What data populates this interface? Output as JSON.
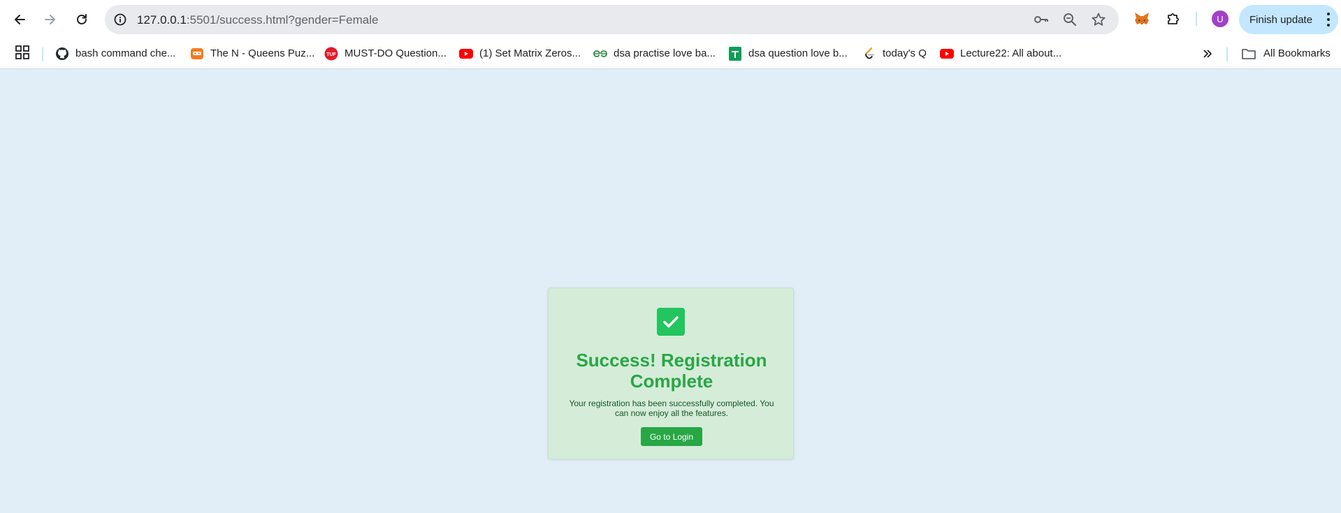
{
  "browser": {
    "url_host": "127.0.0.1",
    "url_rest": ":5501/success.html?gender=Female",
    "profile_initial": "U",
    "finish_update_label": "Finish update"
  },
  "bookmarks": {
    "items": [
      {
        "label": "bash command che...",
        "icon": "github-icon"
      },
      {
        "label": "The N - Queens Puz...",
        "icon": "codingninjas-icon"
      },
      {
        "label": "MUST-DO Question...",
        "icon": "tuf-icon"
      },
      {
        "label": "(1) Set Matrix Zeros...",
        "icon": "youtube-icon"
      },
      {
        "label": "dsa practise love ba...",
        "icon": "geeksforgeeks-icon"
      },
      {
        "label": "dsa question love b...",
        "icon": "google-sheets-icon"
      },
      {
        "label": "today's Q",
        "icon": "leetcode-icon"
      },
      {
        "label": "Lecture22: All about...",
        "icon": "youtube-icon"
      }
    ],
    "all_bookmarks_label": "All Bookmarks"
  },
  "page": {
    "title": "Success! Registration Complete",
    "message": "Your registration has been successfully completed. You can now enjoy all the features.",
    "button_label": "Go to Login"
  },
  "colors": {
    "page_background": "#e1eef7",
    "card_background": "#d5ecd9",
    "success_green": "#28a745",
    "check_green": "#22c55e",
    "message_text": "#155724"
  }
}
